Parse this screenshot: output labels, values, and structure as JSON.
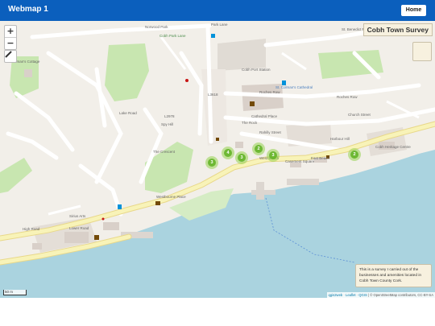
{
  "header": {
    "title": "Webmap 1",
    "home_label": "Home"
  },
  "map": {
    "title": "Cobh Town Survey",
    "zoom_in": "+",
    "zoom_out": "−",
    "scale_label": "50 m",
    "info_text": "This is a survey I carried out of the businesses and amenities located in Cobh Town County Cork.",
    "attribution": {
      "link1": "qgis2web",
      "link2": "Leaflet",
      "link3": "QGIS",
      "rest": " | © OpenStreetMap contributors, CC-BY-SA"
    },
    "clusters": [
      {
        "count": "4"
      },
      {
        "count": "2"
      },
      {
        "count": "3"
      },
      {
        "count": "3"
      },
      {
        "count": "3"
      },
      {
        "count": "2"
      }
    ],
    "street_labels": {
      "norwood": "Norwood Park",
      "park_lane": "Park Lane",
      "roches_row": "Roches Row",
      "roches_row2": "Roches Row",
      "cathedral": "Cathedral Place",
      "the_rock": "The Rock",
      "rahilly": "Rahilly Street",
      "harbour_hill": "Harbour Hill",
      "church_street": "Church Street",
      "high_road": "High Road",
      "lower_road": "Lower Road",
      "westbourne": "Westbourne Place",
      "west_beach": "West Beach",
      "east_beach": "East Beach",
      "casement": "Casement Square",
      "lake_road": "Lake Road",
      "spy_hill": "Spy Hill",
      "the_crescent": "The Crescent",
      "l2978": "L2978",
      "l3618": "L3618",
      "bishop": "St. Benedict Priory",
      "cathedral_name": "St. Colman's Cathedral",
      "heritage": "Cobh Heritage Centre",
      "museum": "Sirius Arts",
      "cobh_park": "Cobh Park Lane",
      "fishermans": "Fisherman's Cottage",
      "station": "Cobh Port Station"
    },
    "colors": {
      "water": "#aad3df",
      "land": "#f2efe9",
      "park": "#c8e6b0",
      "primary_road": "#f8f3b8",
      "cluster": "#96d250"
    }
  }
}
